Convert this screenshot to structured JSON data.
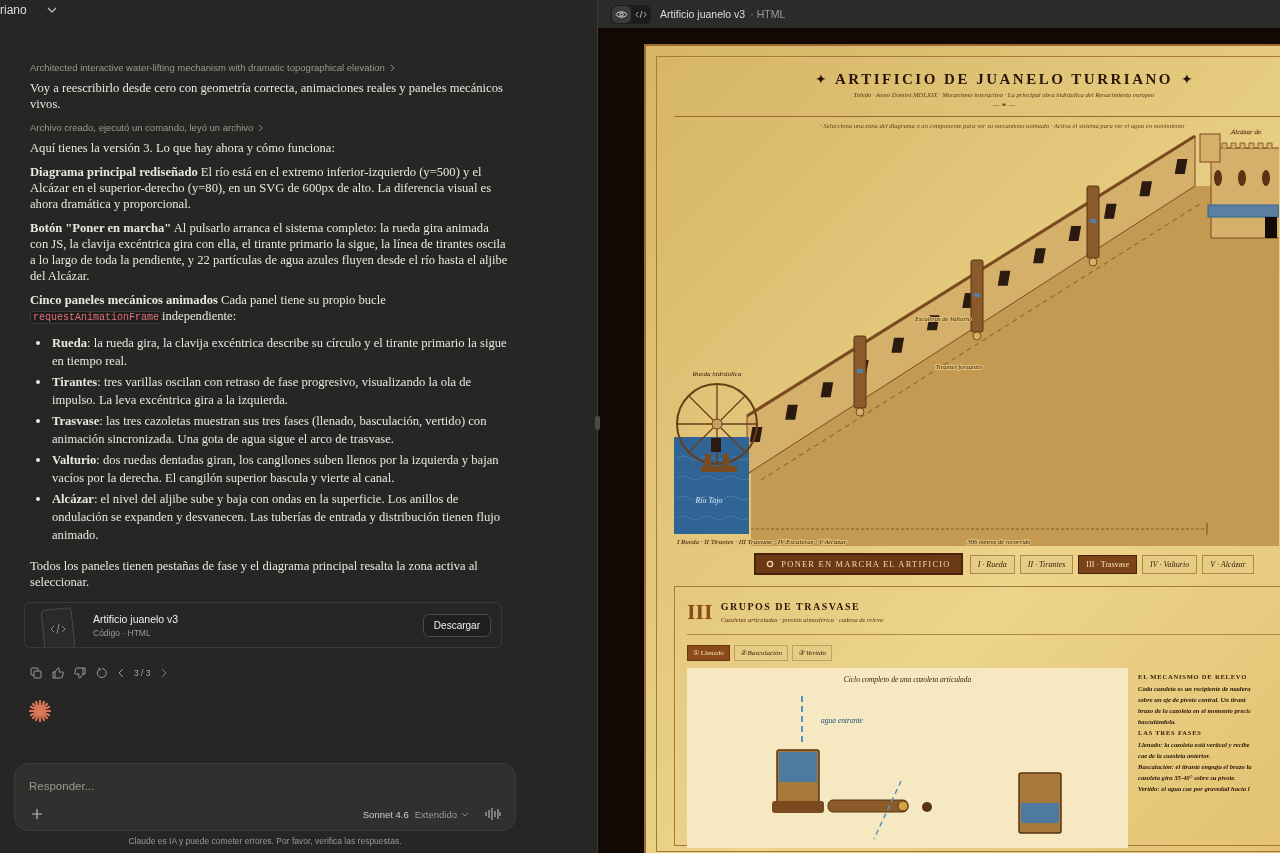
{
  "header": {
    "title": "riano"
  },
  "chat": [
    {
      "kind": "summary",
      "text": "Architected interactive water-lifting mechanism with dramatic topographical elevation"
    },
    {
      "kind": "paragraph",
      "text": "Voy a reescribirlo desde cero con geometría correcta, animaciones reales y paneles mecánicos vivos."
    },
    {
      "kind": "summary",
      "text": "Archivo creado, ejecutó un comando, leyó un archivo"
    },
    {
      "kind": "paragraph",
      "text": "Aquí tienes la versión 3. Lo que hay ahora y cómo funciona:"
    },
    {
      "kind": "paragraph",
      "text": "**Diagrama principal rediseñado** El río está en el extremo inferior-izquierdo (y=500) y el Alcázar en el superior-derecho (y=80), en un SVG de 600px de alto. La diferencia visual es ahora dramática y proporcional."
    },
    {
      "kind": "paragraph",
      "text": "**Botón \"Poner en marcha\"** Al pulsarlo arranca el sistema completo: la rueda gira animada con JS, la clavija excéntrica gira con ella, el tirante primario la sigue, la línea de tirantes oscila a lo largo de toda la pendiente, y 22 partículas de agua azules fluyen desde el río hasta el aljibe del Alcázar."
    },
    {
      "kind": "code_paragraph",
      "before": "**Cinco paneles mecánicos animados** Cada panel tiene su propio bucle",
      "code": "requestAnimationFrame",
      "after": "independiente:"
    },
    {
      "kind": "bullets",
      "items": [
        "**Rueda**: la rueda gira, la clavija excéntrica describe su círculo y el tirante primario la sigue en tiempo real.",
        "**Tirantes**: tres varillas oscilan con retraso de fase progresivo, visualizando la ola de impulso. La leva excéntrica gira a la izquierda.",
        "**Trasvase**: las tres cazoletas muestran sus tres fases (llenado, basculación, vertido) con animación sincronizada. Una gota de agua sigue el arco de trasvase.",
        "**Valturio**: dos ruedas dentadas giran, los cangilones suben llenos por la izquierda y bajan vacíos por la derecha. El cangilón superior bascula y vierte al canal.",
        "**Alcázar**: el nivel del aljibe sube y baja con ondas en la superficie. Los anillos de ondulación se expanden y desvanecen. Las tuberías de entrada y distribución tienen flujo animado."
      ]
    },
    {
      "kind": "paragraph",
      "text": "Todos los paneles tienen pestañas de fase y el diagrama principal resalta la zona activa al seleccionar."
    }
  ],
  "artifact": {
    "title": "Artificio juanelo v3",
    "subtitle": "Código · HTML",
    "button": "Descargar"
  },
  "message_actions": {
    "pager": "3 / 3"
  },
  "composer": {
    "placeholder": "Responder...",
    "model": "Sonnet 4.6",
    "mode": "Extendido"
  },
  "disclaimer": "Claude es IA y puede cometer errores. Por favor, verifica las respuestas.",
  "preview_bar": {
    "toggles": [
      {
        "kind": "preview",
        "selected": true
      },
      {
        "kind": "code",
        "selected": false
      }
    ],
    "title": "Artificio juanelo v3",
    "subtitle": "· HTML"
  },
  "page": {
    "title": "ARTIFICIO DE JUANELO TURRIANO",
    "title_mark": "✦",
    "subtitle": "Toledo · Anno Domini MDLXIX · Mecanismo interactivo · La principal obra hidráulica del Renacimiento europeo",
    "ornament": "— ❧ —",
    "instruction": "· Selecciona una zona del diagrama o un componente para ver su mecanismo animado · Activa el sistema para ver el agua en movimiento ·",
    "diagram_labels": [
      "Rueda hidráulica",
      "Escaleras de Valturio",
      "Tirantes forzantes",
      "Alcázar de",
      "Río Tajo",
      "I Rueda · II Tirantes · III Trasvase · IV Escaleras · V Alcázar",
      "306 metros de recorrido"
    ],
    "start_button": "PONER EN MARCHA EL ARTIFICIO",
    "zones": [
      {
        "label": "I · Rueda",
        "selected": false
      },
      {
        "label": "II · Tirantes",
        "selected": false
      },
      {
        "label": "III · Trasvase",
        "selected": true
      },
      {
        "label": "IV · Valturio",
        "selected": false
      },
      {
        "label": "V · Alcázar",
        "selected": false
      }
    ],
    "section": {
      "numeral": "III",
      "title": "GRUPOS DE TRASVASE",
      "subtitle": "Cazoletas articuladas · presión atmosférica · cadena de relevo",
      "phases": [
        {
          "label": "① Llenado",
          "selected": true
        },
        {
          "label": "② Basculación",
          "selected": false
        },
        {
          "label": "③ Vertido",
          "selected": false
        }
      ],
      "figure": {
        "title": "Ciclo completo de una cazoleta articulada",
        "label": "agua entrante"
      },
      "notes": [
        {
          "heading": "EL MECANISMO DE RELEVO",
          "lines": [
            "Cada cazoleta es un recipiente de madera",
            "sobre un eje de pivote central. Un tirant",
            "brazo de la cazoleta en el momento precis",
            "basculándola."
          ]
        },
        {
          "heading": "LAS TRES FASES",
          "lines": [
            "Llenado: la cazoleta está vertical y recibe",
            "cae de la cazoleta anterior.",
            "Basculación: el tirante empuja el brazo la",
            "cazoleta gira 35-40° sobre su pivote.",
            "Vertido: el agua cae por gravedad hacia l"
          ]
        }
      ]
    }
  }
}
